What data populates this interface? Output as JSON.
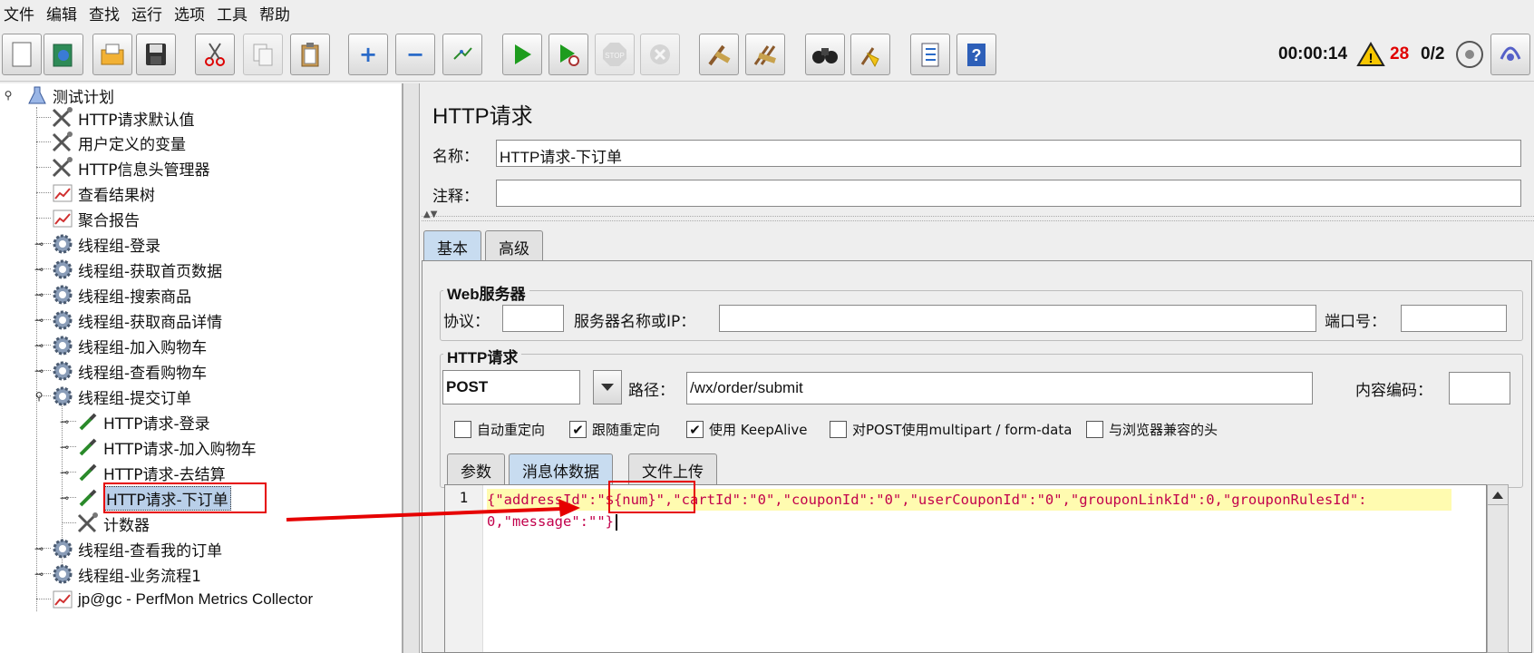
{
  "menu": [
    "文件",
    "编辑",
    "查找",
    "运行",
    "选项",
    "工具",
    "帮助"
  ],
  "status": {
    "elapsed": "00:00:14",
    "warning_count": "28",
    "threads": "0/2"
  },
  "tree": [
    {
      "label": "测试计划",
      "icon": "flask-icon"
    },
    {
      "label": "HTTP请求默认值",
      "icon": "wrench-icon"
    },
    {
      "label": "用户定义的变量",
      "icon": "wrench-icon"
    },
    {
      "label": "HTTP信息头管理器",
      "icon": "wrench-icon"
    },
    {
      "label": "查看结果树",
      "icon": "graph-icon"
    },
    {
      "label": "聚合报告",
      "icon": "graph-icon"
    },
    {
      "label": "线程组-登录",
      "icon": "gear-icon"
    },
    {
      "label": "线程组-获取首页数据",
      "icon": "gear-icon"
    },
    {
      "label": "线程组-搜索商品",
      "icon": "gear-icon"
    },
    {
      "label": "线程组-获取商品详情",
      "icon": "gear-icon"
    },
    {
      "label": "线程组-加入购物车",
      "icon": "gear-icon"
    },
    {
      "label": "线程组-查看购物车",
      "icon": "gear-icon"
    },
    {
      "label": "线程组-提交订单",
      "icon": "gear-icon"
    },
    {
      "label": "HTTP请求-登录",
      "icon": "pipette-icon"
    },
    {
      "label": "HTTP请求-加入购物车",
      "icon": "pipette-icon"
    },
    {
      "label": "HTTP请求-去结算",
      "icon": "pipette-icon"
    },
    {
      "label": "HTTP请求-下订单",
      "icon": "pipette-icon"
    },
    {
      "label": "计数器",
      "icon": "wrench-icon"
    },
    {
      "label": "线程组-查看我的订单",
      "icon": "gear-icon"
    },
    {
      "label": "线程组-业务流程1",
      "icon": "gear-icon"
    },
    {
      "label": "jp@gc - PerfMon Metrics Collector",
      "icon": "graph-icon"
    }
  ],
  "panel": {
    "title": "HTTP请求",
    "name_label": "名称：",
    "name_value": "HTTP请求-下订单",
    "comment_label": "注释：",
    "comment_value": "",
    "tabs": [
      "基本",
      "高级"
    ],
    "web_server": {
      "title": "Web服务器",
      "protocol_label": "协议：",
      "protocol_value": "",
      "server_label": "服务器名称或IP：",
      "server_value": "",
      "port_label": "端口号：",
      "port_value": ""
    },
    "http_request": {
      "title": "HTTP请求",
      "method": "POST",
      "path_label": "路径：",
      "path_value": "/wx/order/submit",
      "encoding_label": "内容编码：",
      "encoding_value": ""
    },
    "checkboxes": [
      {
        "label": "自动重定向",
        "checked": false
      },
      {
        "label": "跟随重定向",
        "checked": true
      },
      {
        "label": "使用 KeepAlive",
        "checked": true
      },
      {
        "label": "对POST使用multipart / form-data",
        "checked": false
      },
      {
        "label": "与浏览器兼容的头",
        "checked": false
      }
    ],
    "body_tabs": [
      "参数",
      "消息体数据",
      "文件上传"
    ],
    "body": {
      "line_number": "1",
      "line1": "{\"addressId\":\"${num}\",\"cartId\":\"0\",\"couponId\":\"0\",\"userCouponId\":\"0\",\"grouponLinkId\":0,\"grouponRulesId\":",
      "line2": "0,\"message\":\"\"}"
    }
  }
}
